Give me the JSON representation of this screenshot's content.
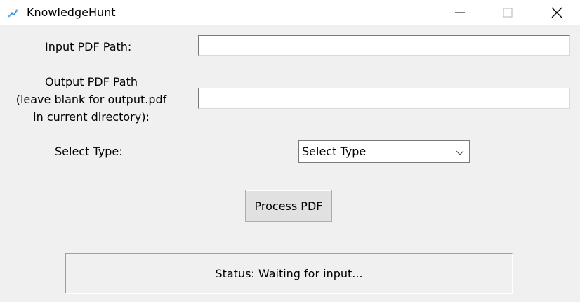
{
  "window": {
    "title": "KnowledgeHunt",
    "controls": {
      "minimize": "minimize-icon",
      "maximize": "maximize-icon",
      "close": "close-icon"
    }
  },
  "form": {
    "input_label": "Input PDF Path:",
    "input_value": "",
    "output_label_lines": [
      "Output PDF Path",
      "(leave blank for output.pdf",
      "in current directory):"
    ],
    "output_value": "",
    "type_label": "Select Type:",
    "type_selected": "Select Type",
    "process_button": "Process PDF"
  },
  "status": {
    "text": "Status: Waiting for input..."
  }
}
